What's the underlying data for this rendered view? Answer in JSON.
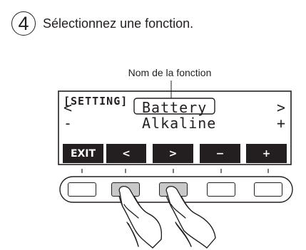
{
  "instruction": {
    "step_number": "4",
    "text": "Sélectionnez une fonction."
  },
  "callout": {
    "label": "Nom de la fonction"
  },
  "display": {
    "title": "[SETTING]",
    "left_arrow": "<",
    "right_arrow": ">",
    "function_name": "Battery",
    "minus_sign": "-",
    "plus_sign": "+",
    "value": "Alkaline"
  },
  "softkeys": [
    {
      "label": "EXIT"
    },
    {
      "label": "<"
    },
    {
      "label": ">"
    },
    {
      "label": "−"
    },
    {
      "label": "+"
    }
  ],
  "colors": {
    "ink": "#231f20",
    "pressed_button": "#c8c8c8"
  }
}
